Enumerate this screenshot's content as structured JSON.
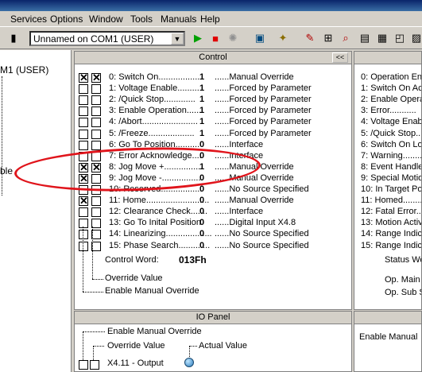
{
  "menubar": {
    "items": [
      "Services",
      "Options",
      "Window",
      "Tools",
      "Manuals",
      "Help"
    ]
  },
  "toolbar": {
    "device_select": "Unnamed on COM1 (USER)",
    "icons": [
      "run-icon",
      "stop-icon",
      "reset-icon",
      "device-icon",
      "wand-icon",
      "pin-icon",
      "scope-icon",
      "search-icon",
      "panel-icon",
      "grid-icon",
      "window-icon",
      "edit-icon"
    ],
    "colors": {
      "run": "#00a000",
      "stop": "#e00000"
    }
  },
  "left_panel": {
    "device_label": "M1 (USER)",
    "partial_label": "ble"
  },
  "control_panel": {
    "title": "Control",
    "collapse_label": "<<",
    "rows": [
      {
        "label": "0: Switch On.................",
        "value": "1",
        "source": "......Manual Override"
      },
      {
        "label": "1: Voltage Enable.........",
        "value": "1",
        "source": "......Forced by Parameter"
      },
      {
        "label": "2: /Quick Stop.............",
        "value": "1",
        "source": "......Forced by Parameter"
      },
      {
        "label": "3: Enable Operation......",
        "value": "1",
        "source": "......Forced by Parameter"
      },
      {
        "label": "4: /Abort.......................",
        "value": "1",
        "source": "......Forced by Parameter"
      },
      {
        "label": "5: /Freeze...................",
        "value": "1",
        "source": "......Forced by Parameter"
      },
      {
        "label": "6: Go To Position..........",
        "value": "0",
        "source": "......Interface"
      },
      {
        "label": "7: Error Acknowledge....",
        "value": "0",
        "source": "......Interface"
      },
      {
        "label": "8: Jog Move +................",
        "value": "1",
        "source": "......Manual Override"
      },
      {
        "label": "9: Jog Move -.................",
        "value": "0",
        "source": "......Manual Override"
      },
      {
        "label": "10: Reserved.................",
        "value": "0",
        "source": "......No Source Specified"
      },
      {
        "label": "11: Home..........................",
        "value": "0",
        "source": "......Manual Override"
      },
      {
        "label": "12: Clearance Check.......",
        "value": "0",
        "source": "......Interface"
      },
      {
        "label": "13: Go To Inital Position",
        "value": "0",
        "source": "......Digital Input X4.8"
      },
      {
        "label": "14: Linearizing...................",
        "value": "0",
        "source": "......No Source Specified"
      },
      {
        "label": "15: Phase Search.............",
        "value": "0",
        "source": "......No Source Specified"
      }
    ],
    "checks": [
      [
        "x",
        "x"
      ],
      [
        "",
        ""
      ],
      [
        "",
        ""
      ],
      [
        "",
        ""
      ],
      [
        "",
        ""
      ],
      [
        "",
        ""
      ],
      [
        "",
        ""
      ],
      [
        "",
        ""
      ],
      [
        "x",
        "x"
      ],
      [
        "x",
        ""
      ],
      [
        "",
        ""
      ],
      [
        "x",
        ""
      ],
      [
        "",
        ""
      ],
      [
        "",
        ""
      ],
      [
        "",
        ""
      ],
      [
        "",
        ""
      ]
    ],
    "control_word_label": "Control Word:",
    "control_word_value": "013Fh",
    "override_value_label": "Override Value",
    "enable_manual_override_label": "Enable Manual Override"
  },
  "status_panel": {
    "rows": [
      "0: Operation Ena",
      "1: Switch On Ac",
      "2: Enable Opera",
      "3: Error...........",
      "4: Voltage Enab",
      "5: /Quick Stop...",
      "6: Switch On Lo",
      "7: Warning...........",
      "8: Event Handle",
      "9: Special Motio",
      "10: In Target Po",
      "11: Homed...........",
      "12: Fatal Error....",
      "13: Motion Activ",
      "14: Range Indic",
      "15: Range Indic"
    ],
    "status_word_label": "Status Wo",
    "op_main_label": "Op. Main S",
    "op_sub_label": "Op. Sub S"
  },
  "io_panel": {
    "title": "IO Panel",
    "enable_manual_override_label": "Enable Manual Override",
    "override_value_label": "Override Value",
    "actual_value_label": "Actual Value",
    "row_label": "X4.11 - Output",
    "right_label": "Enable Manual"
  },
  "annotation": {
    "ring_color": "#e0141b"
  }
}
